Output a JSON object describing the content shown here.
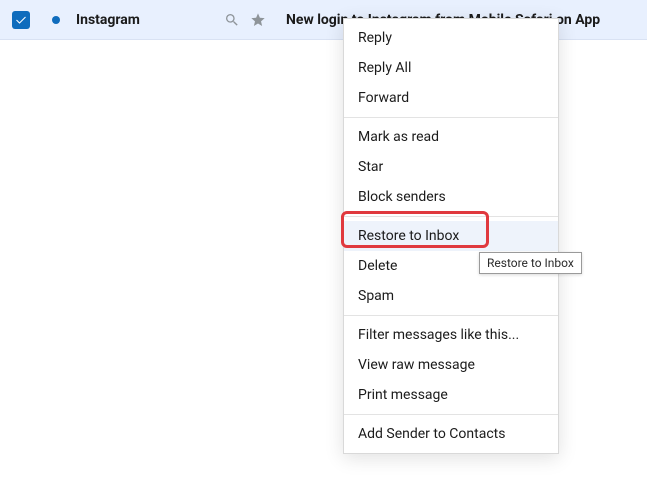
{
  "row": {
    "sender": "Instagram",
    "subject": "New login to Instagram from Mobile Safari on App"
  },
  "menu": {
    "reply": "Reply",
    "reply_all": "Reply All",
    "forward": "Forward",
    "mark_read": "Mark as read",
    "star": "Star",
    "block": "Block senders",
    "restore": "Restore to Inbox",
    "delete": "Delete",
    "spam": "Spam",
    "filter": "Filter messages like this...",
    "view_raw": "View raw message",
    "print": "Print message",
    "add_contact": "Add Sender to Contacts"
  },
  "tooltip": {
    "text": "Restore to Inbox"
  }
}
